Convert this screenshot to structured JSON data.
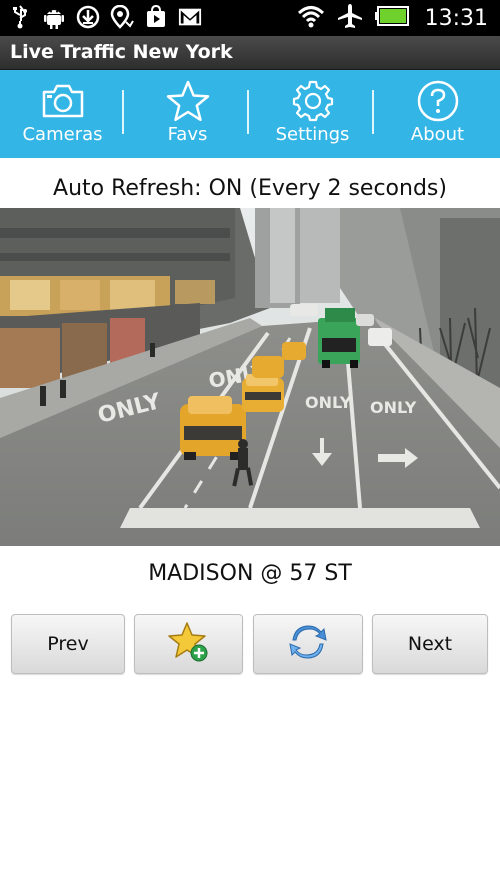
{
  "status_bar": {
    "time": "13:31",
    "icons": [
      "usb-icon",
      "android-debug-icon",
      "download-icon",
      "location-icon",
      "store-icon",
      "gmail-icon",
      "wifi-icon",
      "airplane-icon",
      "battery-icon"
    ]
  },
  "app": {
    "title": "Live Traffic New York"
  },
  "tabs": [
    {
      "label": "Cameras",
      "icon": "camera-icon"
    },
    {
      "label": "Favs",
      "icon": "star-icon"
    },
    {
      "label": "Settings",
      "icon": "gear-icon"
    },
    {
      "label": "About",
      "icon": "help-icon"
    }
  ],
  "refresh": {
    "text": "Auto Refresh: ON (Every 2 seconds)"
  },
  "camera": {
    "name": "MADISON @ 57 ST",
    "road_markings": [
      "ONLY",
      "ONLY",
      "ONLY",
      "ONLY"
    ]
  },
  "buttons": {
    "prev": "Prev",
    "next": "Next",
    "add_fav_icon": "star-add-icon",
    "refresh_icon": "refresh-icon"
  },
  "colors": {
    "accent": "#33b5e5",
    "title_bar": "#3a3a3a",
    "status_bar": "#000000",
    "battery": "#6fd12c"
  }
}
